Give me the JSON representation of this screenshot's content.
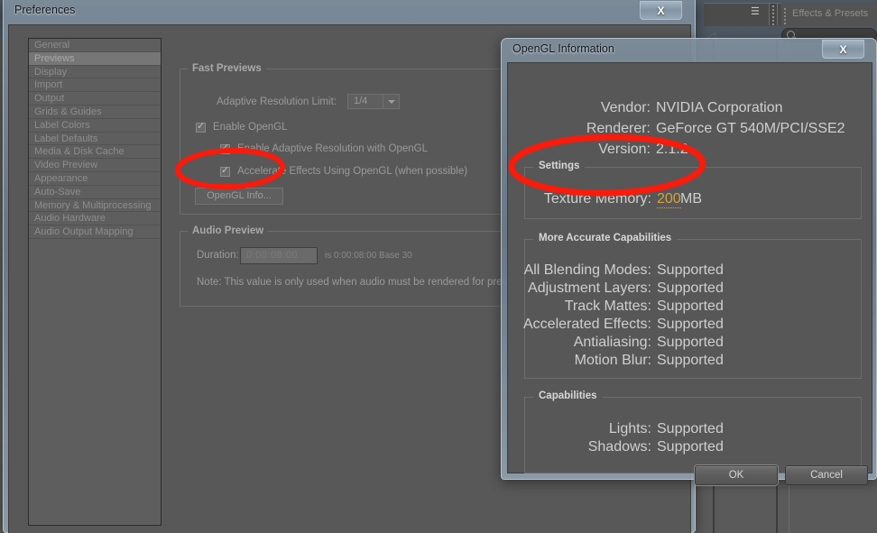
{
  "background": {
    "panel_tab_label": "Effects & Presets",
    "search_placeholder": "",
    "menu_icon": "hamburger-menu-icon"
  },
  "preferences": {
    "title": "Preferences",
    "close_label": "X",
    "categories": [
      {
        "label": "General",
        "selected": false
      },
      {
        "label": "Previews",
        "selected": true
      },
      {
        "label": "Display",
        "selected": false
      },
      {
        "label": "Import",
        "selected": false
      },
      {
        "label": "Output",
        "selected": false
      },
      {
        "label": "Grids & Guides",
        "selected": false
      },
      {
        "label": "Label Colors",
        "selected": false
      },
      {
        "label": "Label Defaults",
        "selected": false
      },
      {
        "label": "Media & Disk Cache",
        "selected": false
      },
      {
        "label": "Video Preview",
        "selected": false
      },
      {
        "label": "Appearance",
        "selected": false
      },
      {
        "label": "Auto-Save",
        "selected": false
      },
      {
        "label": "Memory & Multiprocessing",
        "selected": false
      },
      {
        "label": "Audio Hardware",
        "selected": false
      },
      {
        "label": "Audio Output Mapping",
        "selected": false
      }
    ],
    "fast_previews": {
      "title": "Fast Previews",
      "adaptive_resolution_limit_label": "Adaptive Resolution Limit:",
      "adaptive_resolution_limit_value": "1/4",
      "enable_opengl_label": "Enable OpenGL",
      "enable_adaptive_resolution_label": "Enable Adaptive Resolution with OpenGL",
      "accelerate_effects_label": "Accelerate Effects Using OpenGL (when possible)",
      "opengl_info_button": "OpenGL Info..."
    },
    "audio_preview": {
      "title": "Audio Preview",
      "duration_label": "Duration:",
      "duration_value": "0:00:08:00",
      "duration_suffix": "is 0:00:08:00  Base 30",
      "note": "Note: This value is only used when audio must be rendered for previ"
    }
  },
  "opengl_dialog": {
    "title": "OpenGL Information",
    "close_label": "X",
    "info": [
      {
        "key": "Vendor:",
        "value": "NVIDIA Corporation"
      },
      {
        "key": "Renderer:",
        "value": "GeForce GT 540M/PCI/SSE2"
      },
      {
        "key": "Version:",
        "value": "2.1.2"
      }
    ],
    "settings": {
      "title": "Settings",
      "texture_memory_label": "Texture Memory:",
      "texture_memory_value": "200",
      "texture_memory_unit": "MB"
    },
    "more_accurate_capabilities": {
      "title": "More Accurate Capabilities",
      "rows": [
        {
          "key": "All Blending Modes:",
          "value": "Supported"
        },
        {
          "key": "Adjustment Layers:",
          "value": "Supported"
        },
        {
          "key": "Track Mattes:",
          "value": "Supported"
        },
        {
          "key": "Accelerated Effects:",
          "value": "Supported"
        },
        {
          "key": "Antialiasing:",
          "value": "Supported"
        },
        {
          "key": "Motion Blur:",
          "value": "Supported"
        }
      ]
    },
    "capabilities": {
      "title": "Capabilities",
      "rows": [
        {
          "key": "Lights:",
          "value": "Supported"
        },
        {
          "key": "Shadows:",
          "value": "Supported"
        }
      ]
    },
    "ok_button": "OK",
    "cancel_button": "Cancel"
  },
  "annotations": {
    "color": "#f91b0b",
    "ellipse_1_target": "opengl-info-button",
    "ellipse_2_target": "texture-memory-row"
  }
}
